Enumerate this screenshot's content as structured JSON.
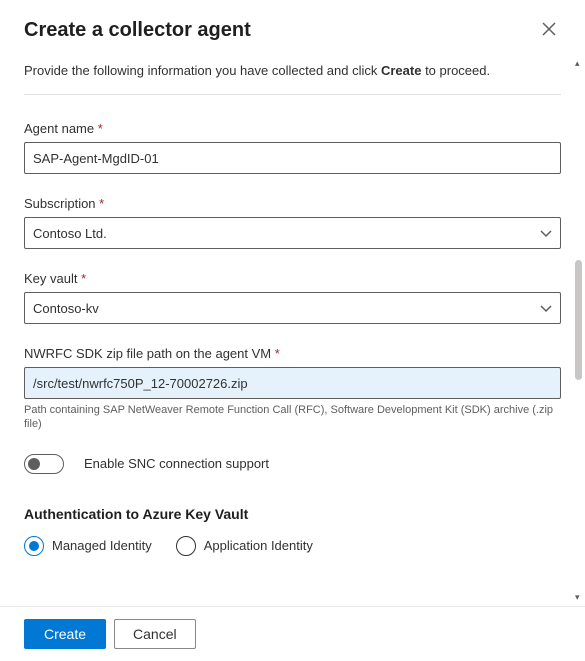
{
  "header": {
    "title": "Create a collector agent"
  },
  "intro": {
    "prefix": "Provide the following information you have collected and click ",
    "bold": "Create",
    "suffix": " to proceed."
  },
  "fields": {
    "agent_name": {
      "label": "Agent name",
      "value": "SAP-Agent-MgdID-01"
    },
    "subscription": {
      "label": "Subscription",
      "value": "Contoso Ltd."
    },
    "key_vault": {
      "label": "Key vault",
      "value": "Contoso-kv"
    },
    "sdk_path": {
      "label": "NWRFC SDK zip file path on the agent VM",
      "value": "/src/test/nwrfc750P_12-70002726.zip",
      "hint": "Path containing SAP NetWeaver Remote Function Call (RFC), Software Development Kit (SDK) archive (.zip file)"
    }
  },
  "toggle": {
    "label": "Enable SNC connection support",
    "on": false
  },
  "auth": {
    "title": "Authentication to Azure Key Vault",
    "options": {
      "managed": "Managed Identity",
      "application": "Application Identity"
    },
    "selected": "managed"
  },
  "footer": {
    "create": "Create",
    "cancel": "Cancel"
  },
  "required_marker": " *"
}
